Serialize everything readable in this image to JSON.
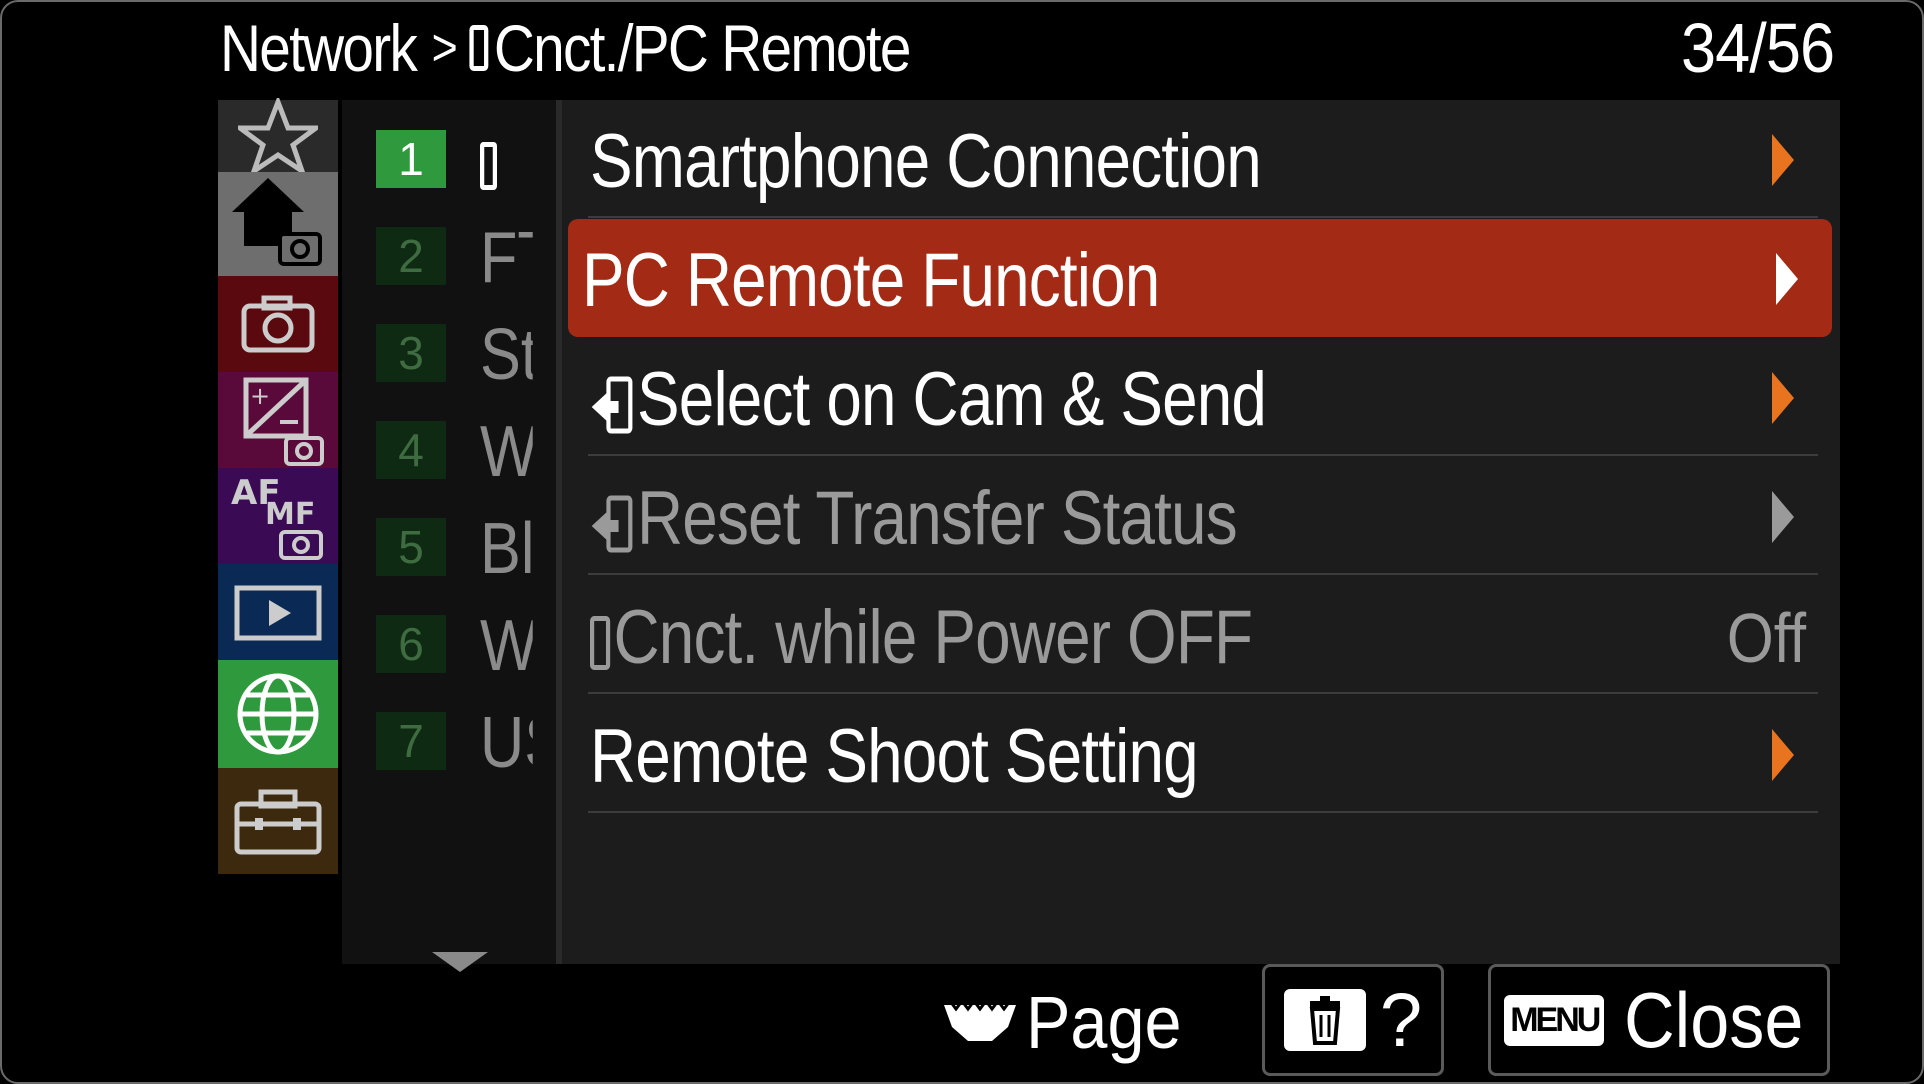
{
  "header": {
    "breadcrumb_root": "Network",
    "breadcrumb_sep": ">",
    "breadcrumb_current": "Cnct./PC Remote",
    "page_indicator": "34/56"
  },
  "categories": [
    {
      "icon": "star-icon",
      "bg": "#2a2a2a"
    },
    {
      "icon": "home-camera-icon",
      "bg": "#6e6e6e"
    },
    {
      "icon": "camera-icon",
      "bg": "#5a0a0e"
    },
    {
      "icon": "exposure-camera-icon",
      "bg": "#5a0a3a"
    },
    {
      "icon": "af-mf-camera-icon",
      "bg": "#3b0a55"
    },
    {
      "icon": "playback-icon",
      "bg": "#0a2a55"
    },
    {
      "icon": "network-globe-icon",
      "bg": "#2f9a3d"
    },
    {
      "icon": "toolbox-icon",
      "bg": "#3d2a0e"
    }
  ],
  "sub_pages": [
    {
      "num": "1",
      "label": "",
      "active": true
    },
    {
      "num": "2",
      "label": "FT",
      "active": false
    },
    {
      "num": "3",
      "label": "St",
      "active": false
    },
    {
      "num": "4",
      "label": "W",
      "active": false
    },
    {
      "num": "5",
      "label": "Bl",
      "active": false
    },
    {
      "num": "6",
      "label": "W",
      "active": false
    },
    {
      "num": "7",
      "label": "US",
      "active": false
    }
  ],
  "menu_items": [
    {
      "label": "Smartphone Connection",
      "state": "normal",
      "value": ""
    },
    {
      "label": "PC Remote Function",
      "state": "selected",
      "value": ""
    },
    {
      "label": "Select on Cam & Send",
      "state": "normal",
      "value": ""
    },
    {
      "label": "Reset Transfer Status",
      "state": "dim",
      "value": ""
    },
    {
      "label": "Cnct. while Power OFF",
      "state": "dim",
      "value": "Off"
    },
    {
      "label": "Remote Shoot Setting",
      "state": "normal",
      "value": ""
    }
  ],
  "footer": {
    "page_label": "Page",
    "help_label": "?",
    "menu_badge": "MENU",
    "close_label": "Close"
  },
  "colors": {
    "selected_row": "#a32a14",
    "arrow_accent": "#e8741f",
    "network_tab": "#2f9a3d"
  }
}
